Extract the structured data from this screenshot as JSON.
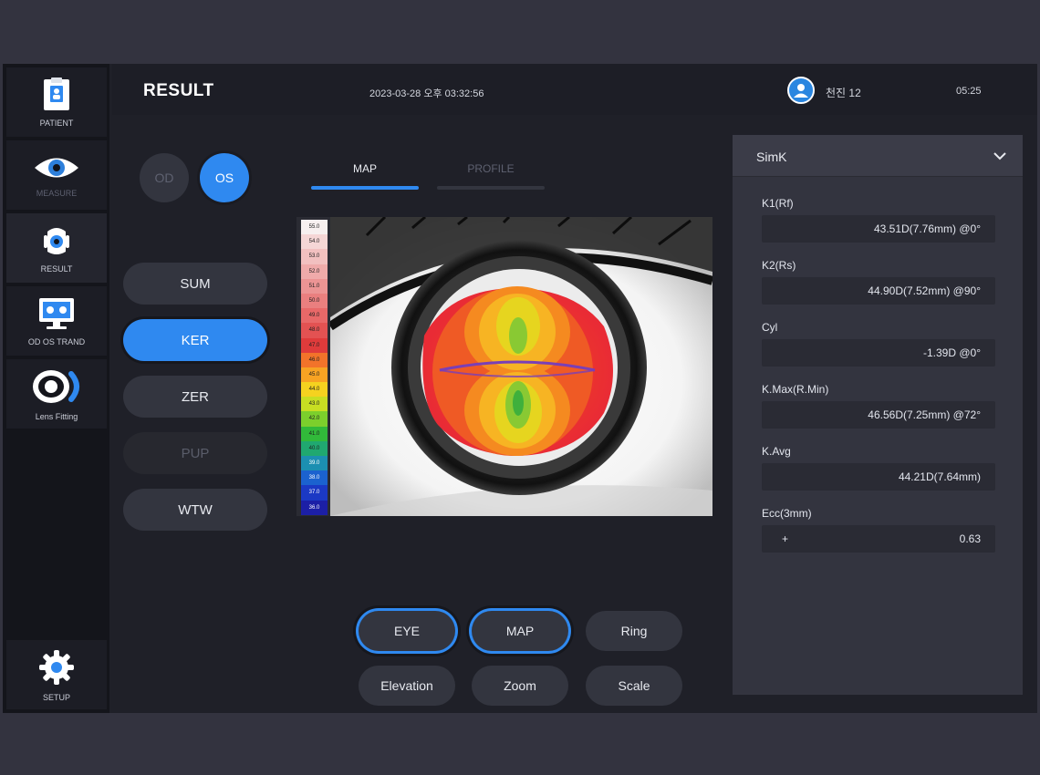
{
  "sidebar": {
    "items": [
      {
        "label": "PATIENT",
        "icon": "patient-icon"
      },
      {
        "label": "MEASURE",
        "icon": "eye-icon"
      },
      {
        "label": "RESULT",
        "icon": "result-icon"
      },
      {
        "label": "OD OS TRAND",
        "icon": "monitor-trend-icon"
      },
      {
        "label": "Lens Fitting",
        "icon": "lens-fitting-icon"
      }
    ],
    "setup": {
      "label": "SETUP",
      "icon": "gear-icon"
    }
  },
  "header": {
    "title": "RESULT",
    "datetime": "2023-03-28 오후 03:32:56",
    "user": "천진 12",
    "clock": "05:25"
  },
  "eye_select": {
    "od": "OD",
    "os": "OS",
    "selected": "OS"
  },
  "metrics": {
    "buttons": [
      {
        "label": "SUM",
        "state": "normal"
      },
      {
        "label": "KER",
        "state": "active"
      },
      {
        "label": "ZER",
        "state": "normal"
      },
      {
        "label": "PUP",
        "state": "disabled"
      },
      {
        "label": "WTW",
        "state": "normal"
      }
    ]
  },
  "tabs": {
    "map": "MAP",
    "profile": "PROFILE",
    "active": "MAP"
  },
  "color_scale": {
    "labels": [
      "55.0",
      "54.0",
      "53.0",
      "52.0",
      "51.0",
      "50.0",
      "49.0",
      "48.0",
      "47.0",
      "46.0",
      "45.0",
      "44.0",
      "43.0",
      "42.0",
      "41.0",
      "40.0",
      "39.0",
      "38.0",
      "37.0",
      "36.0"
    ],
    "colors": [
      "#f7f0f0",
      "#f5d6d6",
      "#f2c0c0",
      "#efaaaa",
      "#ec9494",
      "#ea7f7f",
      "#e86868",
      "#e35252",
      "#df3b3b",
      "#f2732a",
      "#f7a323",
      "#f5d21f",
      "#c8de22",
      "#7ccf2c",
      "#31b93a",
      "#20a870",
      "#1c8fb1",
      "#1b62cf",
      "#1b39c4",
      "#1c1fa6"
    ]
  },
  "view_buttons": [
    {
      "label": "EYE",
      "active": true
    },
    {
      "label": "MAP",
      "active": true
    },
    {
      "label": "Ring",
      "active": false
    },
    {
      "label": "Elevation",
      "active": false
    },
    {
      "label": "Zoom",
      "active": false
    },
    {
      "label": "Scale",
      "active": false
    }
  ],
  "panel": {
    "select": "SimK",
    "fields": [
      {
        "label": "K1(Rf)",
        "value": "43.51D(7.76mm) @0°"
      },
      {
        "label": "K2(Rs)",
        "value": "44.90D(7.52mm) @90°"
      },
      {
        "label": "Cyl",
        "value": "-1.39D @0°"
      },
      {
        "label": "K.Max(R.Min)",
        "value": "46.56D(7.25mm) @72°"
      },
      {
        "label": "K.Avg",
        "value": "44.21D(7.64mm)"
      },
      {
        "label": "Ecc(3mm)",
        "sign": "+",
        "value": "0.63"
      }
    ]
  }
}
